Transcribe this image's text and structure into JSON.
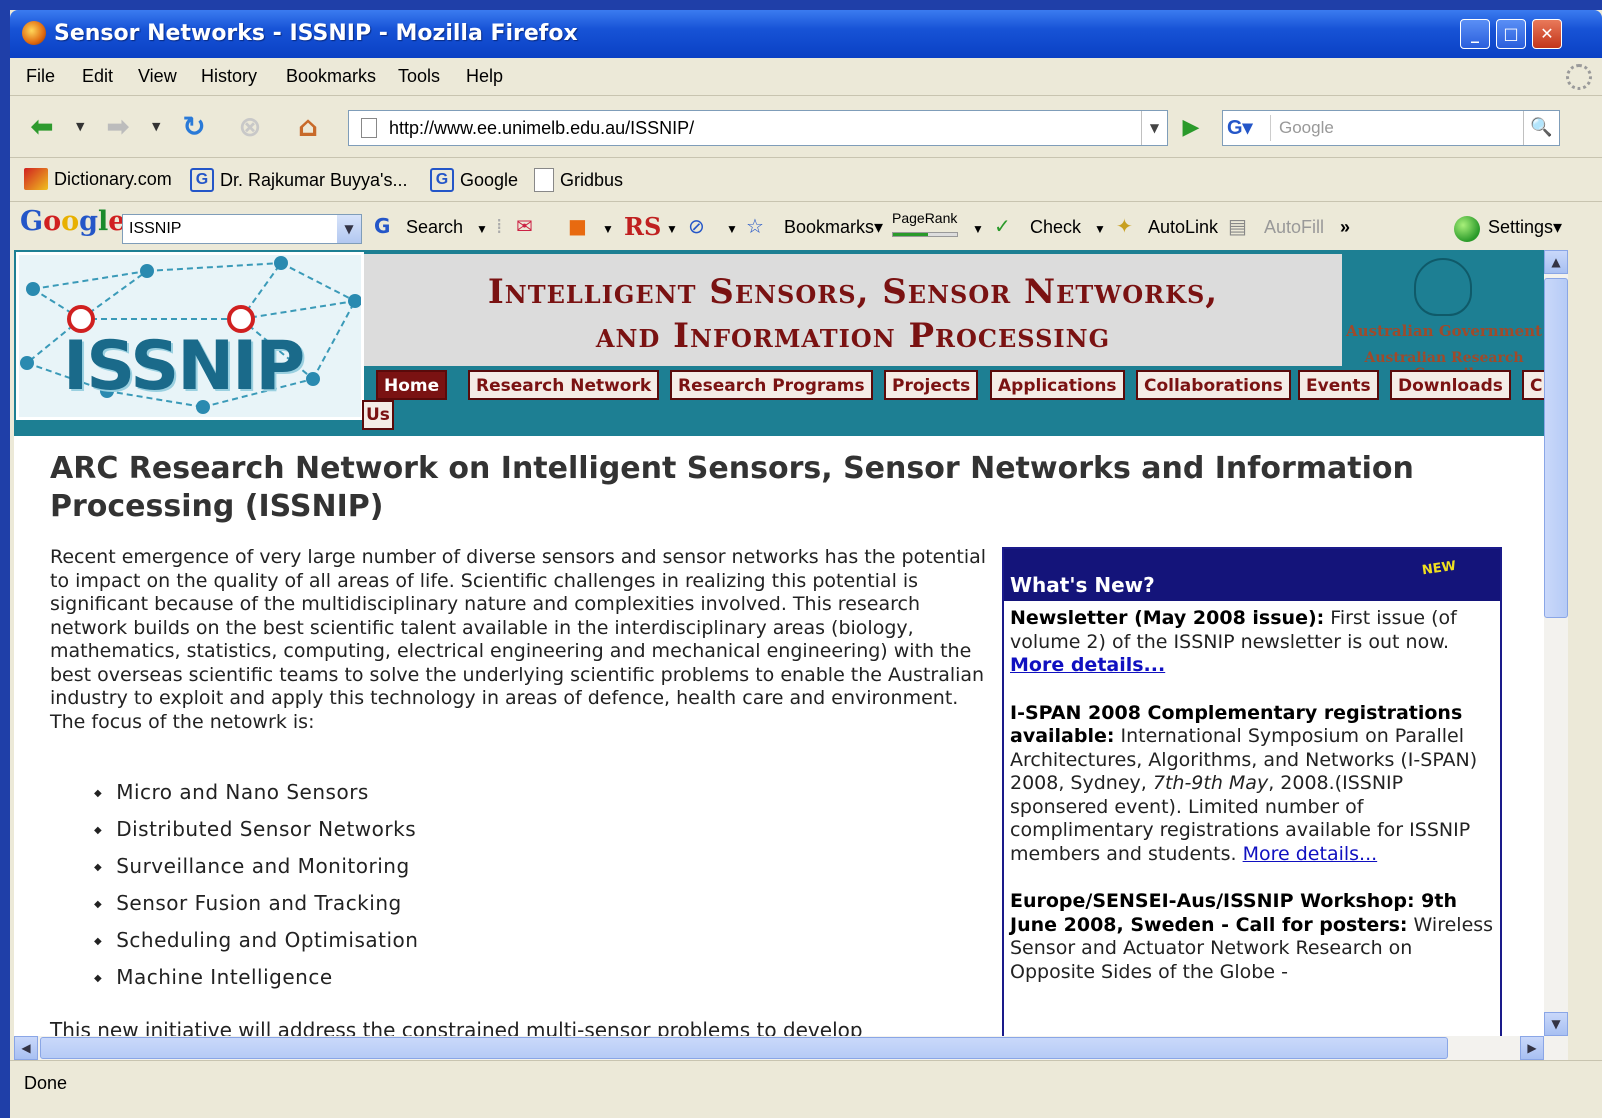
{
  "window": {
    "title": "Sensor Networks - ISSNIP - Mozilla Firefox"
  },
  "menu": [
    "File",
    "Edit",
    "View",
    "History",
    "Bookmarks",
    "Tools",
    "Help"
  ],
  "navigation": {
    "url": "http://www.ee.unimelb.edu.au/ISSNIP/",
    "search_placeholder": "Google"
  },
  "bookmarks": [
    "Dictionary.com",
    "Dr. Rajkumar Buyya's...",
    "Google",
    "Gridbus"
  ],
  "google_toolbar": {
    "query": "ISSNIP",
    "search_label": "Search",
    "rs_label": "RS",
    "bookmarks_label": "Bookmarks▾",
    "pagerank_label": "PageRank",
    "check_label": "Check",
    "autolink_label": "AutoLink",
    "autofill_label": "AutoFill",
    "more_label": "»",
    "settings_label": "Settings▾"
  },
  "site": {
    "logo_text": "ISSNIP",
    "banner_line1": "Intelligent Sensors, Sensor Networks,",
    "banner_line2": "and Information Processing",
    "gov_line1": "Australian Government",
    "gov_line2": "Australian Research Council",
    "nav": [
      "Home",
      "Research Network",
      "Research Programs",
      "Projects",
      "Applications",
      "Collaborations",
      "Events",
      "Downloads",
      "C"
    ],
    "nav_overflow": "Us"
  },
  "page": {
    "heading": "ARC Research Network on Intelligent Sensors, Sensor Networks and Information Processing (ISSNIP)",
    "intro": "Recent emergence of very large number of diverse sensors and sensor networks has the potential to impact on the quality of all areas of life. Scientific challenges in realizing this potential is significant because of the multidisciplinary nature and complexities involved. This research network builds on the best scientific talent available in the interdisciplinary areas (biology, mathematics, statistics, computing, electrical engineering and mechanical engineering) with the best overseas scientific teams to solve the underlying scientific problems to enable the Australian industry to exploit and apply this technology in areas of defence, health care and environment. The focus of the netowrk is:",
    "focus_items": [
      "Micro and Nano Sensors",
      "Distributed Sensor Networks",
      "Surveillance and Monitoring",
      "Sensor Fusion and Tracking",
      "Scheduling and Optimisation",
      "Machine Intelligence"
    ],
    "next_paragraph": "This new initiative will address the constrained multi-sensor problems to develop"
  },
  "whats_new": {
    "title": "What's New?",
    "badge": "NEW",
    "items": [
      {
        "head": "Newsletter (May 2008 issue):",
        "text": " First issue (of volume 2) of the ISSNIP newsletter is out now. ",
        "link": "More details..."
      },
      {
        "head": "I-SPAN 2008 Complementary registrations available:",
        "text1": " International Symposium on Parallel Architectures, Algorithms, and Networks (I-SPAN) 2008, Sydney, ",
        "em": "7th-9th May",
        "text2": ", 2008.(ISSNIP sponsered event). Limited number of complimentary registrations available for ISSNIP members and students. ",
        "link": "More details..."
      },
      {
        "head": "Europe/SENSEI-Aus/ISSNIP Workshop: 9th June 2008, Sweden - Call for posters:",
        "text": " Wireless Sensor and Actuator Network Research on Opposite Sides of the Globe -"
      }
    ]
  },
  "status": "Done",
  "colors": {
    "title_bar": "#1753d6",
    "banner_text": "#7a1212",
    "header_teal": "#1d7f93",
    "news_header": "#14147a",
    "link": "#1010c0"
  }
}
